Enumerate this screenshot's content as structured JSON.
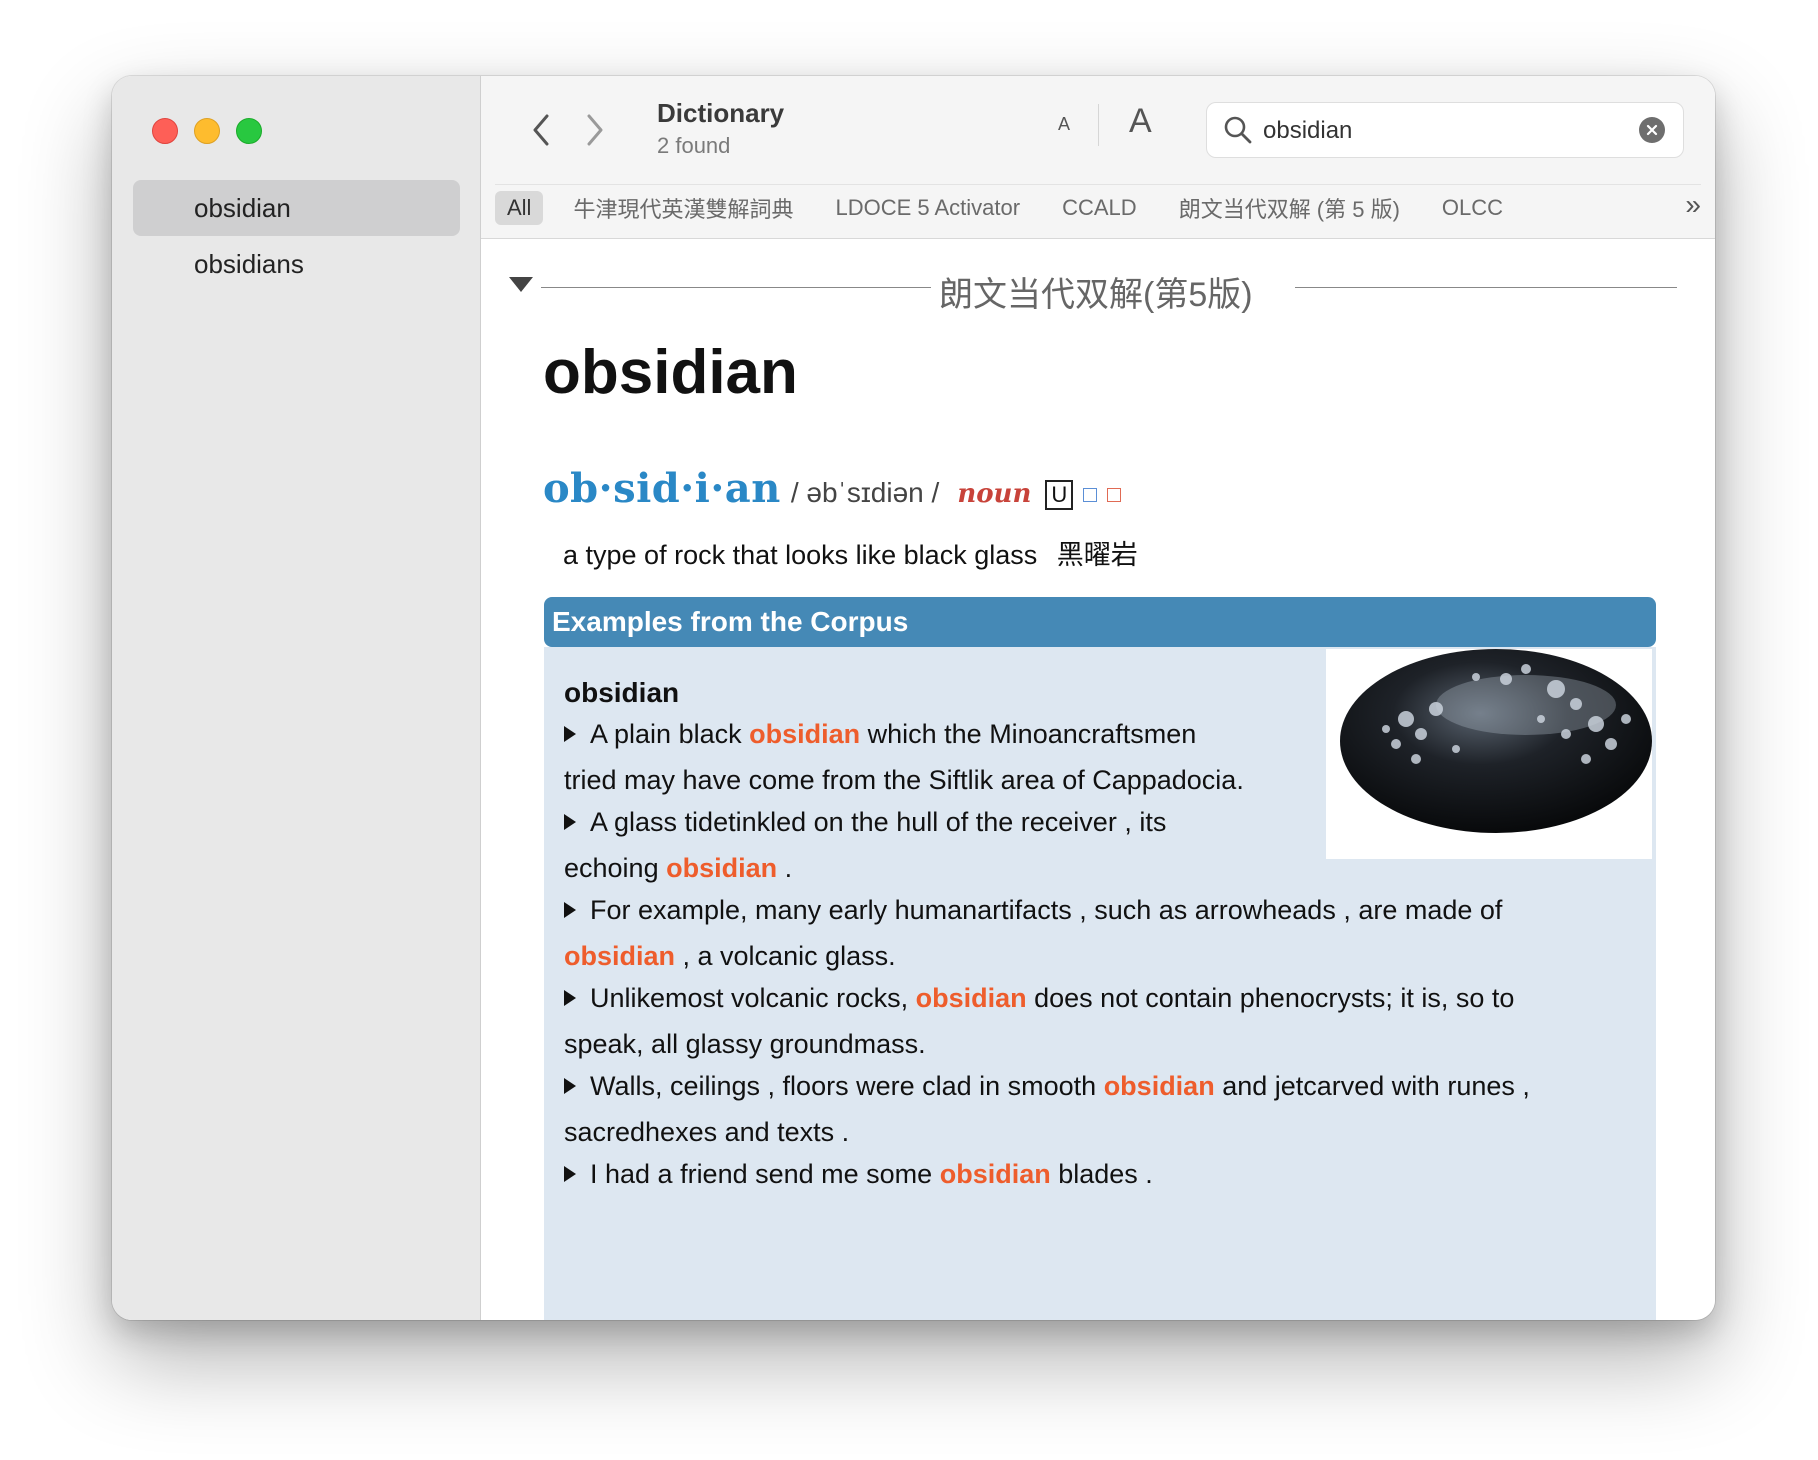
{
  "sidebar": {
    "items": [
      {
        "label": "obsidian"
      },
      {
        "label": "obsidians"
      }
    ]
  },
  "toolbar": {
    "title": "Dictionary",
    "subtitle": "2 found",
    "font_small": "A",
    "font_large": "A"
  },
  "search": {
    "value": "obsidian",
    "icon": "search-icon"
  },
  "filters": {
    "items": [
      {
        "label": "All"
      },
      {
        "label": "牛津現代英漢雙解詞典"
      },
      {
        "label": "LDOCE 5 Activator"
      },
      {
        "label": "CCALD"
      },
      {
        "label": "朗文当代双解 (第 5 版)"
      },
      {
        "label": "OLCC"
      }
    ],
    "more": "»"
  },
  "section": {
    "title": "朗文当代双解(第5版)"
  },
  "entry": {
    "headword": "obsidian",
    "syllables": "ob·sid·i·an",
    "pronunciation": "/ əbˈsɪdiən /",
    "part_of_speech": "noun",
    "grammar": "U",
    "definition": "a type of rock that looks like black glass",
    "definition_zh": "黑曜岩"
  },
  "examples": {
    "header": "Examples from the Corpus",
    "word": "obsidian",
    "items": [
      {
        "before": "A plain black ",
        "hl": "obsidian",
        "after": " which the Minoancraftsmen",
        "line2": "tried may have come from the Siftlik area of Cappadocia."
      },
      {
        "before": "A glass tidetinkled on the hull of the receiver , its",
        "line2_before": "echoing ",
        "line2_hl": "obsidian",
        "line2_after": " ."
      },
      {
        "before": "For example, many early humanartifacts , such as arrowheads , are made of",
        "line2_hl": "obsidian",
        "line2_after": " , a volcanic glass."
      },
      {
        "before": "Unlikemost volcanic rocks, ",
        "hl": "obsidian",
        "after": " does not contain phenocrysts; it is, so to",
        "line2": "speak, all glassy groundmass."
      },
      {
        "before": "Walls, ceilings , floors were clad in smooth ",
        "hl": "obsidian",
        "after": " and jetcarved with runes ,",
        "line2": "sacredhexes and texts ."
      },
      {
        "before": "I had a friend send me some ",
        "hl": "obsidian",
        "after": " blades ."
      }
    ]
  }
}
